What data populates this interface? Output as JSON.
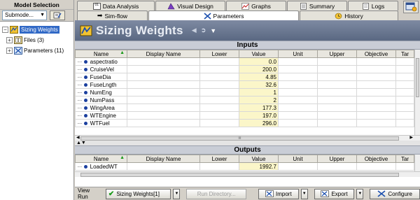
{
  "model_selection": {
    "title": "Model Selection",
    "submode_label": "Submode...",
    "tree": {
      "root": "Sizing Weights",
      "children": [
        "Files (3)",
        "Parameters (11)"
      ]
    }
  },
  "tabs": {
    "row1": [
      "Data Analysis",
      "Visual Design",
      "Graphs",
      "Summary",
      "Logs"
    ],
    "row2": [
      "Sim-flow",
      "Parameters",
      "History"
    ],
    "active": "Parameters"
  },
  "title": "Sizing Weights",
  "columns": [
    "Name",
    "Display Name",
    "Lower",
    "Value",
    "Unit",
    "Upper",
    "Objective",
    "Tar"
  ],
  "inputs": {
    "header": "Inputs",
    "rows": [
      {
        "name": "aspectratio",
        "value": "0.0"
      },
      {
        "name": "CruiseVel",
        "value": "200.0"
      },
      {
        "name": "FuseDia",
        "value": "4.85"
      },
      {
        "name": "FuseLngth",
        "value": "32.6"
      },
      {
        "name": "NumEng",
        "value": "1"
      },
      {
        "name": "NumPass",
        "value": "2"
      },
      {
        "name": "WingArea",
        "value": "177.3"
      },
      {
        "name": "WTEngine",
        "value": "197.0"
      },
      {
        "name": "WTFuel",
        "value": "296.0"
      }
    ]
  },
  "outputs": {
    "header": "Outputs",
    "rows": [
      {
        "name": "LoadedWT",
        "value": "1992.7"
      }
    ]
  },
  "scroll_marker": "III",
  "bottom": {
    "view_run_label": "View Run",
    "run_selected": "Sizing Weights[1]",
    "run_directory": "Run Directory...",
    "import": "Import",
    "export": "Export",
    "configure": "Configure"
  }
}
